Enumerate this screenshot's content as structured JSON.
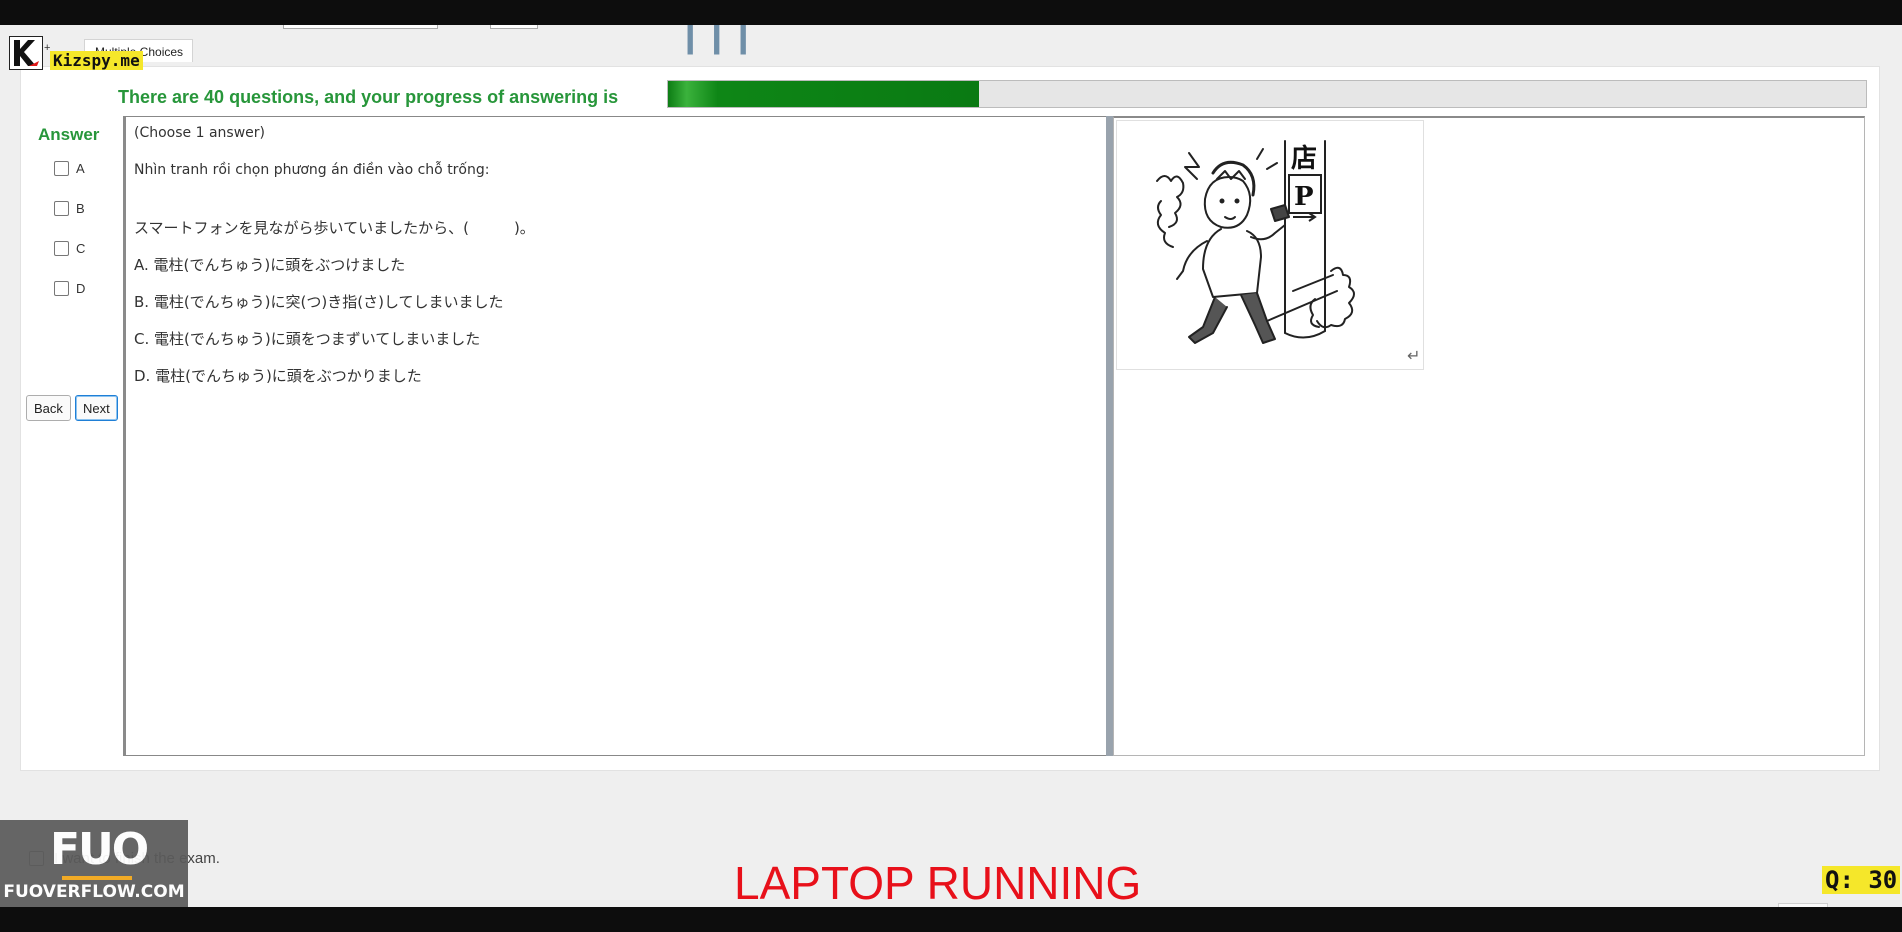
{
  "tab": {
    "arrow": "+",
    "label": "Multiple Choices"
  },
  "progress": {
    "text": "There are 40 questions, and your progress of answering is",
    "fraction": 0.26
  },
  "answer_panel": {
    "heading": "Answer",
    "options": [
      "A",
      "B",
      "C",
      "D"
    ]
  },
  "nav": {
    "back_label": "Back",
    "next_label": "Next"
  },
  "question": {
    "instruction": "(Choose 1 answer)",
    "prompt": "Nhìn tranh rồi chọn phương án điền vào chỗ trống:",
    "sentence": "スマートフォンを見ながら歩いていましたから、(　　　)。",
    "choices": [
      "A.  電柱(でんちゅう)に頭をぶつけました",
      "B.  電柱(でんちゅう)に突(つ)き指(さ)してしまいました",
      "C.  電柱(でんちゅう)に頭をつまずいてしまいました",
      "D.  電柱(でんちゅう)に頭をぶつかりました"
    ]
  },
  "illustration": {
    "icon": "man-hitting-pole-illustration",
    "sign_kanji": "店",
    "sign_letter": "P",
    "return_mark": "↵"
  },
  "finish": {
    "label": "I want to finish the exam."
  },
  "status_banner": "LAPTOP RUNNING",
  "watermark_left": {
    "mark": "FUO",
    "url": "FUOVERFLOW.COM"
  },
  "watermark_top": {
    "text": "Kizspy.me"
  },
  "question_counter": "Q: 30",
  "colors": {
    "accent_green": "#27963a",
    "progress_fill": "#0d7d15",
    "banner_red": "#e8101a",
    "highlight_yellow": "#f5e72a"
  }
}
